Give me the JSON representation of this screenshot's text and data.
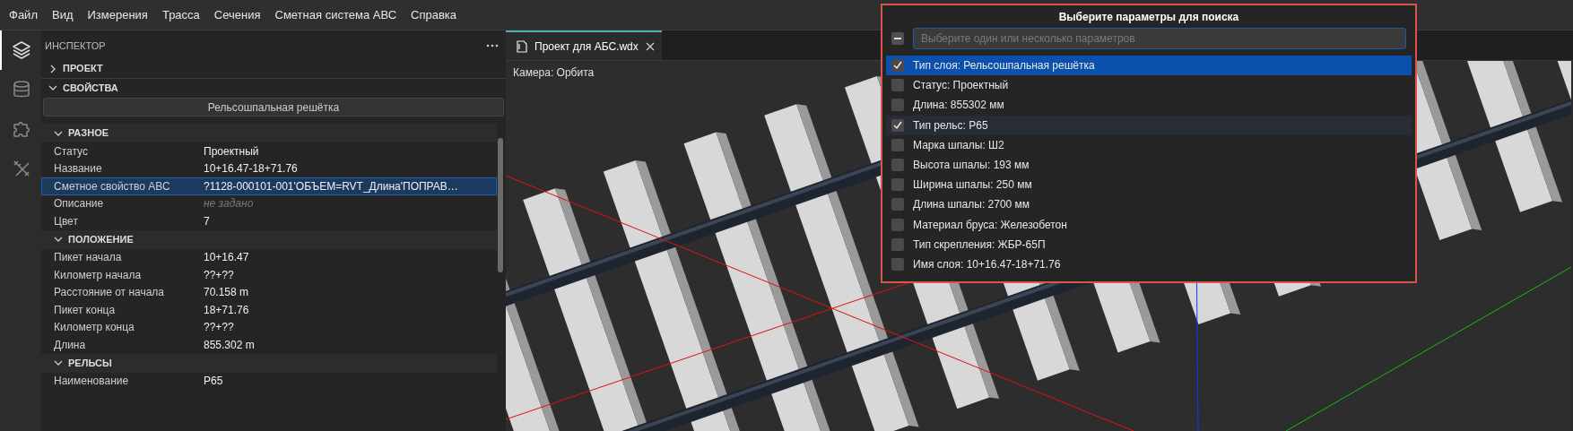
{
  "menu": [
    "Файл",
    "Вид",
    "Измерения",
    "Трасса",
    "Сечения",
    "Сметная система АВС",
    "Справка"
  ],
  "activity_bar": [
    {
      "kind": "layers",
      "selected": true
    },
    {
      "kind": "database",
      "selected": false
    },
    {
      "kind": "puzzle",
      "selected": false
    },
    {
      "kind": "tools",
      "selected": false
    }
  ],
  "inspector": {
    "title": "ИНСПЕКТОР",
    "sections": [
      {
        "label": "ПРОЕКТ",
        "expanded": false
      },
      {
        "label": "СВОЙСТВА",
        "expanded": true
      }
    ],
    "object_name": "Рельсошпальная решётка",
    "groups": [
      {
        "label": "РАЗНОЕ",
        "expanded": true,
        "rows": [
          {
            "name": "Статус",
            "value": "Проектный",
            "selected": false,
            "unset": false
          },
          {
            "name": "Название",
            "value": "10+16.47-18+71.76",
            "selected": false,
            "unset": false
          },
          {
            "name": "Сметное свойство АВС",
            "value": "?1128-000101-001'ОБЪЕМ=RVT_Длина'ПОПРАВ…",
            "selected": true,
            "unset": false
          },
          {
            "name": "Описание",
            "value": "не задано",
            "selected": false,
            "unset": true
          },
          {
            "name": "Цвет",
            "value": "7",
            "selected": false,
            "unset": false
          }
        ]
      },
      {
        "label": "ПОЛОЖЕНИЕ",
        "expanded": true,
        "rows": [
          {
            "name": "Пикет начала",
            "value": "10+16.47",
            "selected": false,
            "unset": false
          },
          {
            "name": "Километр начала",
            "value": "??+??",
            "selected": false,
            "unset": false
          },
          {
            "name": "Расстояние от начала",
            "value": "70.158 m",
            "selected": false,
            "unset": false
          },
          {
            "name": "Пикет конца",
            "value": "18+71.76",
            "selected": false,
            "unset": false
          },
          {
            "name": "Километр конца",
            "value": "??+??",
            "selected": false,
            "unset": false
          },
          {
            "name": "Длина",
            "value": "855.302 m",
            "selected": false,
            "unset": false
          }
        ]
      },
      {
        "label": "РЕЛЬСЫ",
        "expanded": true,
        "rows": [
          {
            "name": "Наименование",
            "value": "Р65",
            "selected": false,
            "unset": false
          }
        ]
      }
    ]
  },
  "editor": {
    "tabs": [
      {
        "label": "Проект для АБС.wdx",
        "selected": true
      }
    ],
    "camera": "Камера: Орбита"
  },
  "search_popup": {
    "title": "Выберите параметры для поиска",
    "select_all": {
      "indeterminate": true
    },
    "placeholder": "Выберите один или несколько параметров",
    "items": [
      {
        "label": "Тип слоя: Рельсошпальная решётка",
        "checked": true,
        "selected": true,
        "hovered": false
      },
      {
        "label": "Статус: Проектный",
        "checked": false,
        "selected": false,
        "hovered": false
      },
      {
        "label": "Длина: 855302 мм",
        "checked": false,
        "selected": false,
        "hovered": false
      },
      {
        "label": "Тип рельс: Р65",
        "checked": true,
        "selected": false,
        "hovered": true
      },
      {
        "label": "Марка шпалы: Ш2",
        "checked": false,
        "selected": false,
        "hovered": false
      },
      {
        "label": "Высота шпалы: 193 мм",
        "checked": false,
        "selected": false,
        "hovered": false
      },
      {
        "label": "Ширина шпалы: 250 мм",
        "checked": false,
        "selected": false,
        "hovered": false
      },
      {
        "label": "Длина шпалы: 2700 мм",
        "checked": false,
        "selected": false,
        "hovered": false
      },
      {
        "label": "Материал бруса: Железобетон",
        "checked": false,
        "selected": false,
        "hovered": false
      },
      {
        "label": "Тип скрепления: ЖБР-65П",
        "checked": false,
        "selected": false,
        "hovered": false
      },
      {
        "label": "Имя слоя: 10+16.47-18+71.76",
        "checked": false,
        "selected": false,
        "hovered": false
      }
    ]
  }
}
